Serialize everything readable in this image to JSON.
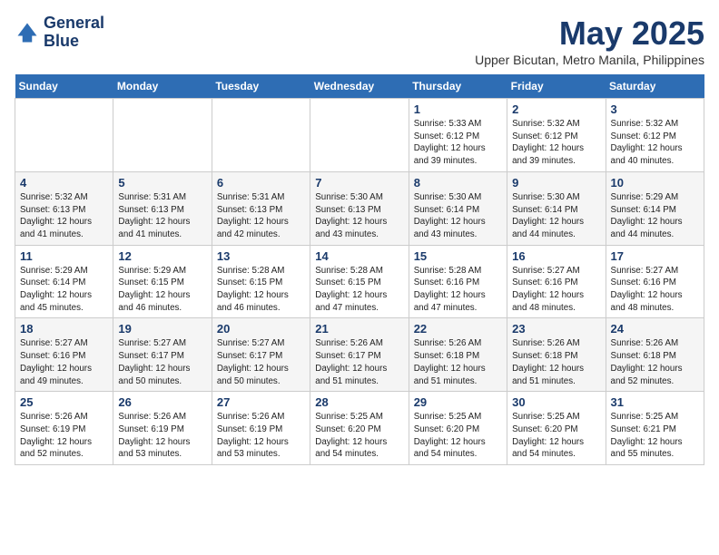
{
  "logo": {
    "line1": "General",
    "line2": "Blue"
  },
  "title": "May 2025",
  "location": "Upper Bicutan, Metro Manila, Philippines",
  "days_header": [
    "Sunday",
    "Monday",
    "Tuesday",
    "Wednesday",
    "Thursday",
    "Friday",
    "Saturday"
  ],
  "weeks": [
    [
      {
        "day": "",
        "info": ""
      },
      {
        "day": "",
        "info": ""
      },
      {
        "day": "",
        "info": ""
      },
      {
        "day": "",
        "info": ""
      },
      {
        "day": "1",
        "info": "Sunrise: 5:33 AM\nSunset: 6:12 PM\nDaylight: 12 hours\nand 39 minutes."
      },
      {
        "day": "2",
        "info": "Sunrise: 5:32 AM\nSunset: 6:12 PM\nDaylight: 12 hours\nand 39 minutes."
      },
      {
        "day": "3",
        "info": "Sunrise: 5:32 AM\nSunset: 6:12 PM\nDaylight: 12 hours\nand 40 minutes."
      }
    ],
    [
      {
        "day": "4",
        "info": "Sunrise: 5:32 AM\nSunset: 6:13 PM\nDaylight: 12 hours\nand 41 minutes."
      },
      {
        "day": "5",
        "info": "Sunrise: 5:31 AM\nSunset: 6:13 PM\nDaylight: 12 hours\nand 41 minutes."
      },
      {
        "day": "6",
        "info": "Sunrise: 5:31 AM\nSunset: 6:13 PM\nDaylight: 12 hours\nand 42 minutes."
      },
      {
        "day": "7",
        "info": "Sunrise: 5:30 AM\nSunset: 6:13 PM\nDaylight: 12 hours\nand 43 minutes."
      },
      {
        "day": "8",
        "info": "Sunrise: 5:30 AM\nSunset: 6:14 PM\nDaylight: 12 hours\nand 43 minutes."
      },
      {
        "day": "9",
        "info": "Sunrise: 5:30 AM\nSunset: 6:14 PM\nDaylight: 12 hours\nand 44 minutes."
      },
      {
        "day": "10",
        "info": "Sunrise: 5:29 AM\nSunset: 6:14 PM\nDaylight: 12 hours\nand 44 minutes."
      }
    ],
    [
      {
        "day": "11",
        "info": "Sunrise: 5:29 AM\nSunset: 6:14 PM\nDaylight: 12 hours\nand 45 minutes."
      },
      {
        "day": "12",
        "info": "Sunrise: 5:29 AM\nSunset: 6:15 PM\nDaylight: 12 hours\nand 46 minutes."
      },
      {
        "day": "13",
        "info": "Sunrise: 5:28 AM\nSunset: 6:15 PM\nDaylight: 12 hours\nand 46 minutes."
      },
      {
        "day": "14",
        "info": "Sunrise: 5:28 AM\nSunset: 6:15 PM\nDaylight: 12 hours\nand 47 minutes."
      },
      {
        "day": "15",
        "info": "Sunrise: 5:28 AM\nSunset: 6:16 PM\nDaylight: 12 hours\nand 47 minutes."
      },
      {
        "day": "16",
        "info": "Sunrise: 5:27 AM\nSunset: 6:16 PM\nDaylight: 12 hours\nand 48 minutes."
      },
      {
        "day": "17",
        "info": "Sunrise: 5:27 AM\nSunset: 6:16 PM\nDaylight: 12 hours\nand 48 minutes."
      }
    ],
    [
      {
        "day": "18",
        "info": "Sunrise: 5:27 AM\nSunset: 6:16 PM\nDaylight: 12 hours\nand 49 minutes."
      },
      {
        "day": "19",
        "info": "Sunrise: 5:27 AM\nSunset: 6:17 PM\nDaylight: 12 hours\nand 50 minutes."
      },
      {
        "day": "20",
        "info": "Sunrise: 5:27 AM\nSunset: 6:17 PM\nDaylight: 12 hours\nand 50 minutes."
      },
      {
        "day": "21",
        "info": "Sunrise: 5:26 AM\nSunset: 6:17 PM\nDaylight: 12 hours\nand 51 minutes."
      },
      {
        "day": "22",
        "info": "Sunrise: 5:26 AM\nSunset: 6:18 PM\nDaylight: 12 hours\nand 51 minutes."
      },
      {
        "day": "23",
        "info": "Sunrise: 5:26 AM\nSunset: 6:18 PM\nDaylight: 12 hours\nand 51 minutes."
      },
      {
        "day": "24",
        "info": "Sunrise: 5:26 AM\nSunset: 6:18 PM\nDaylight: 12 hours\nand 52 minutes."
      }
    ],
    [
      {
        "day": "25",
        "info": "Sunrise: 5:26 AM\nSunset: 6:19 PM\nDaylight: 12 hours\nand 52 minutes."
      },
      {
        "day": "26",
        "info": "Sunrise: 5:26 AM\nSunset: 6:19 PM\nDaylight: 12 hours\nand 53 minutes."
      },
      {
        "day": "27",
        "info": "Sunrise: 5:26 AM\nSunset: 6:19 PM\nDaylight: 12 hours\nand 53 minutes."
      },
      {
        "day": "28",
        "info": "Sunrise: 5:25 AM\nSunset: 6:20 PM\nDaylight: 12 hours\nand 54 minutes."
      },
      {
        "day": "29",
        "info": "Sunrise: 5:25 AM\nSunset: 6:20 PM\nDaylight: 12 hours\nand 54 minutes."
      },
      {
        "day": "30",
        "info": "Sunrise: 5:25 AM\nSunset: 6:20 PM\nDaylight: 12 hours\nand 54 minutes."
      },
      {
        "day": "31",
        "info": "Sunrise: 5:25 AM\nSunset: 6:21 PM\nDaylight: 12 hours\nand 55 minutes."
      }
    ]
  ]
}
